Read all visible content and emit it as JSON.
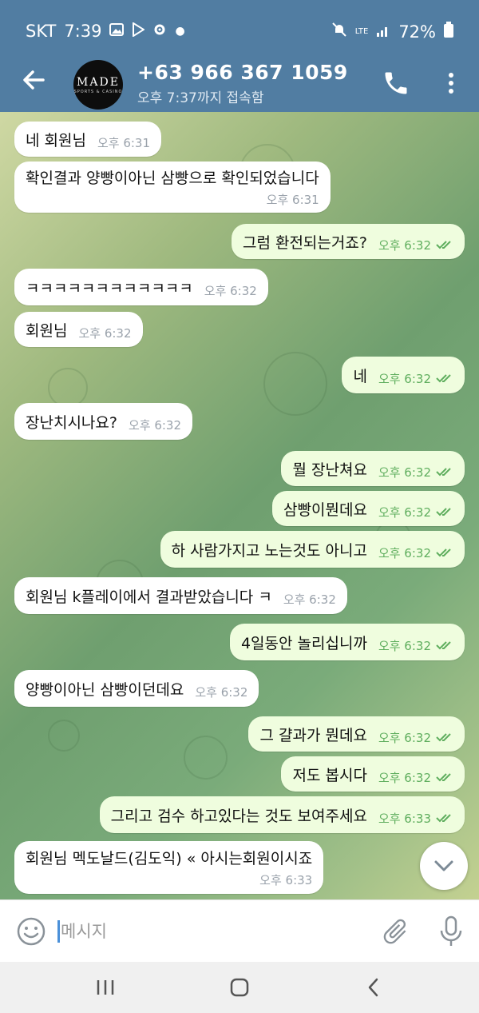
{
  "status_bar": {
    "carrier": "SKT",
    "time": "7:39",
    "network": "LTE",
    "battery": "72%"
  },
  "header": {
    "avatar_logo": "MADE",
    "avatar_logo_sub": "SPORTS & CASINO",
    "title": "+63 966 367 1059",
    "subtitle": "오후 7:37까지 접속함"
  },
  "messages": [
    {
      "dir": "in",
      "text": "네 회원님",
      "time": "오후 6:31"
    },
    {
      "dir": "in",
      "text": "확인결과 양빵이아닌 삼빵으로 확인되었습니다",
      "time": "오후 6:31"
    },
    {
      "dir": "out",
      "text": "그럼 환전되는거죠?",
      "time": "오후 6:32"
    },
    {
      "dir": "in",
      "text": "ㅋㅋㅋㅋㅋㅋㅋㅋㅋㅋㅋㅋ",
      "time": "오후 6:32"
    },
    {
      "dir": "in",
      "text": "회원님",
      "time": "오후 6:32"
    },
    {
      "dir": "out",
      "text": "네",
      "time": "오후 6:32"
    },
    {
      "dir": "in",
      "text": "장난치시나요?",
      "time": "오후 6:32"
    },
    {
      "dir": "out",
      "text": "뭘 장난쳐요",
      "time": "오후 6:32"
    },
    {
      "dir": "out",
      "text": "삼빵이뭔데요",
      "time": "오후 6:32"
    },
    {
      "dir": "out",
      "text": "하 사람가지고 노는것도 아니고",
      "time": "오후 6:32"
    },
    {
      "dir": "in",
      "text": "회원님 k플레이에서 결과받았습니다 ㅋ",
      "time": "오후 6:32"
    },
    {
      "dir": "out",
      "text": "4일동안 놀리십니까",
      "time": "오후 6:32"
    },
    {
      "dir": "in",
      "text": "양빵이아닌 삼빵이던데요",
      "time": "오후 6:32"
    },
    {
      "dir": "out",
      "text": "그 걀과가 뭔데요",
      "time": "오후 6:32"
    },
    {
      "dir": "out",
      "text": "저도 봅시다",
      "time": "오후 6:32"
    },
    {
      "dir": "out",
      "text": "그리고 검수 하고있다는 것도 보여주세요",
      "time": "오후 6:33"
    },
    {
      "dir": "in",
      "text": "회원님 멕도날드(김도익) « 아시는회원이시죠",
      "time": "오후 6:33"
    }
  ],
  "input": {
    "placeholder": "메시지"
  },
  "colors": {
    "header": "#517da2",
    "incoming_bubble": "#ffffff",
    "outgoing_bubble": "#effdde",
    "read_check": "#5fae5e"
  }
}
